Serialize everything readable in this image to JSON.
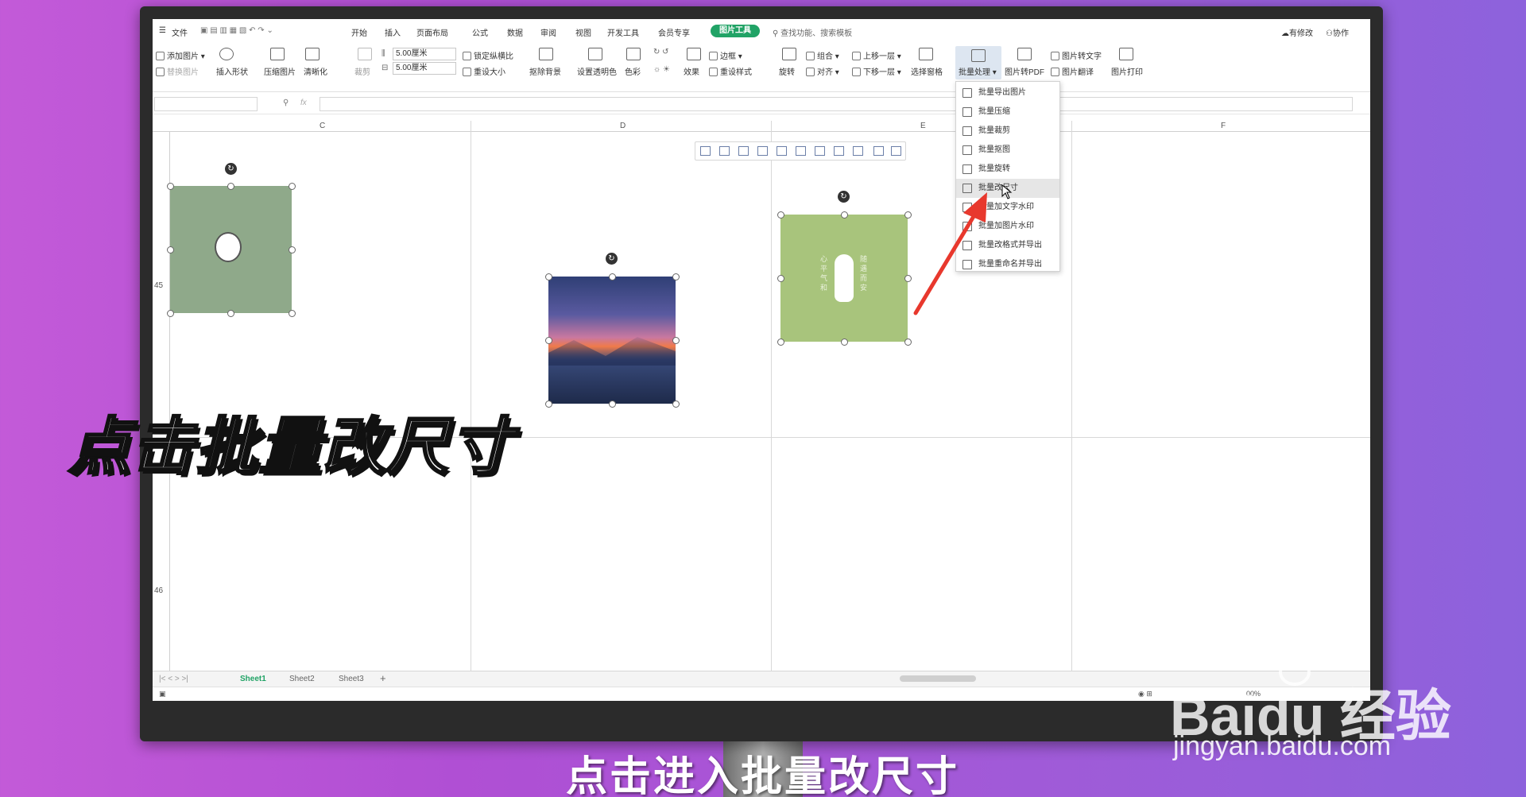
{
  "menubar": {
    "file": "文件",
    "tabs": [
      "开始",
      "插入",
      "页面布局",
      "公式",
      "数据",
      "审阅",
      "视图",
      "开发工具",
      "会员专享"
    ],
    "active_tab": "图片工具",
    "search_placeholder": "查找功能、搜索模板",
    "right_items": [
      "有修改",
      "协作"
    ]
  },
  "ribbon": {
    "add_picture": "添加图片",
    "replace_picture": "替换图片",
    "insert_shape": "插入形状",
    "compress": "压缩图片",
    "clarity": "清晰化",
    "crop": "裁剪",
    "height": "5.00厘米",
    "width": "5.00厘米",
    "lock_ratio": "锁定纵横比",
    "reset_size": "重设大小",
    "remove_bg": "抠除背景",
    "set_transparent": "设置透明色",
    "color": "色彩",
    "effects": "效果",
    "border": "边框",
    "reset_style": "重设样式",
    "rotate": "旋转",
    "group": "组合",
    "align": "对齐",
    "bring_forward": "上移一层",
    "send_backward": "下移一层",
    "selection_pane": "选择窗格",
    "batch": "批量处理",
    "to_pdf": "图片转PDF",
    "to_text": "图片转文字",
    "translate": "图片翻译",
    "print": "图片打印"
  },
  "formula": {
    "fx": "fx"
  },
  "columns": [
    "C",
    "D",
    "E",
    "F"
  ],
  "rows": [
    "45",
    "46"
  ],
  "dropdown": [
    "批量导出图片",
    "批量压缩",
    "批量裁剪",
    "批量抠图",
    "批量旋转",
    "批量改尺寸",
    "批量加文字水印",
    "批量加图片水印",
    "批量改格式并导出",
    "批量重命名并导出"
  ],
  "pic3_text": [
    "心平气和",
    "随遇而安"
  ],
  "sheets": [
    "Sheet1",
    "Sheet2",
    "Sheet3"
  ],
  "zoom_text": "00%",
  "overlay": {
    "caption": "点击批量改尺寸",
    "subtitle": "点击进入批量改尺寸",
    "watermark": "Baidu 经验",
    "watermark_url": "jingyan.baidu.com"
  },
  "colors": {
    "accent": "#21a366",
    "pic1_bg": "#8fa98a",
    "pic3_bg": "#a8c47c",
    "arrow": "#e8382d"
  }
}
